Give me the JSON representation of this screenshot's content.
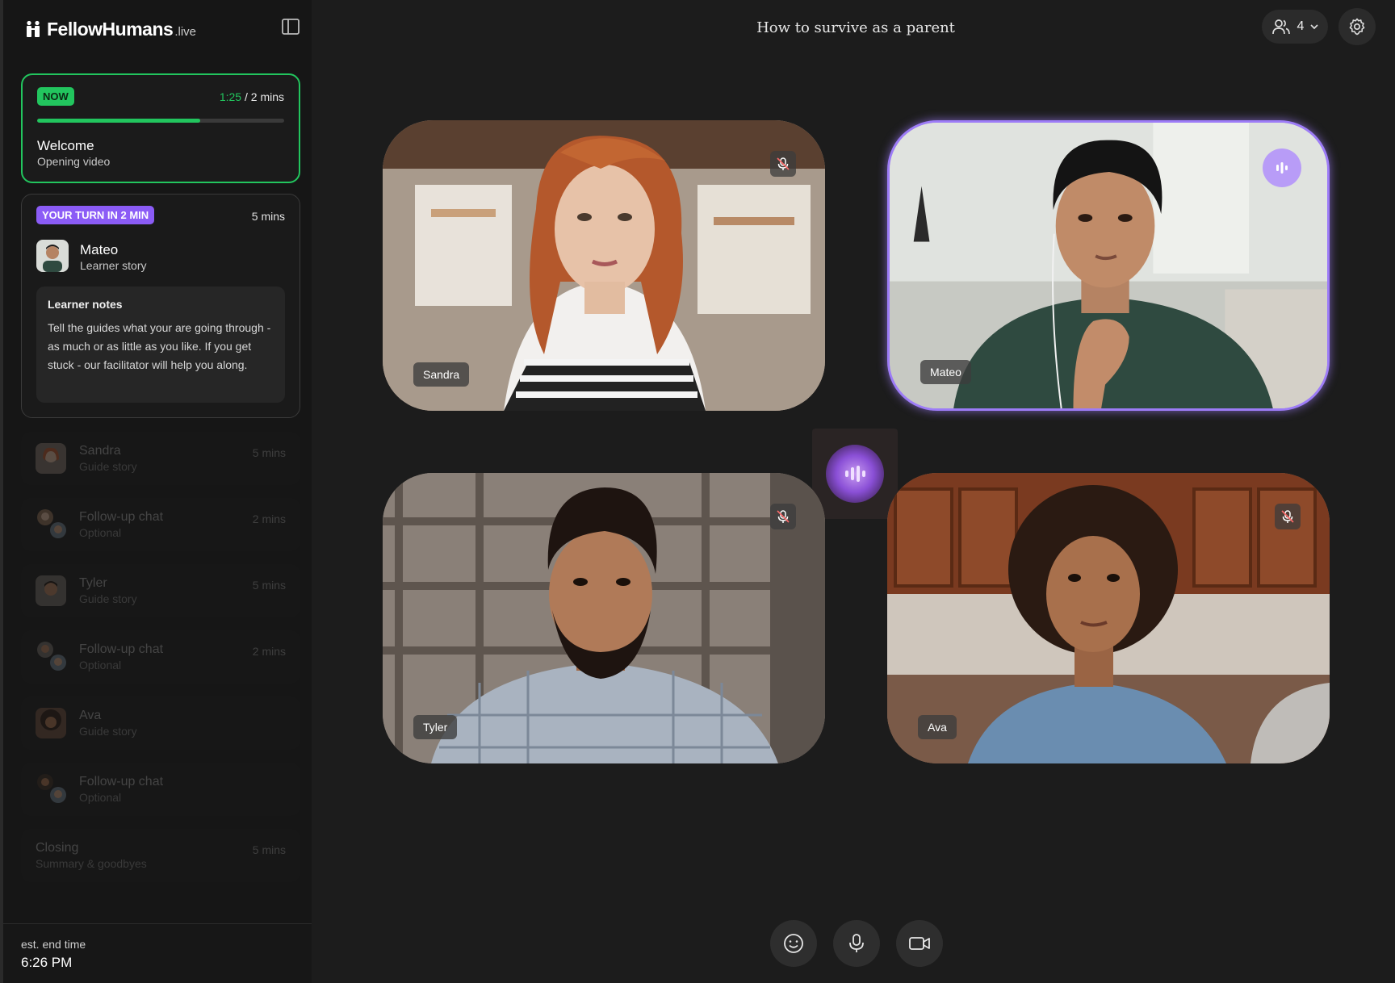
{
  "brand": {
    "name": "FellowHumans",
    "suffix": ".live"
  },
  "header": {
    "session_title": "How to survive as a parent",
    "participant_count": "4"
  },
  "now_card": {
    "badge": "NOW",
    "elapsed": "1:25",
    "total": " / 2 mins",
    "progress_percent": 66,
    "title": "Welcome",
    "subtitle": "Opening video"
  },
  "turn_card": {
    "badge": "YOUR TURN IN 2 MIN",
    "duration": "5 mins",
    "name": "Mateo",
    "subtitle": "Learner story",
    "notes_title": "Learner notes",
    "notes_body": "Tell the guides what your are going through - as much or as little as you like. If you get stuck - our facilitator will help you along."
  },
  "agenda": [
    {
      "name": "Sandra",
      "sub": "Guide story",
      "time": "5 mins"
    },
    {
      "name": "Follow-up chat",
      "sub": "Optional",
      "time": "2 mins"
    },
    {
      "name": "Tyler",
      "sub": "Guide story",
      "time": "5 mins"
    },
    {
      "name": "Follow-up chat",
      "sub": "Optional",
      "time": "2 mins"
    },
    {
      "name": "Ava",
      "sub": "Guide story",
      "time": ""
    },
    {
      "name": "Follow-up chat",
      "sub": "Optional",
      "time": ""
    },
    {
      "name": "Closing",
      "sub": "Summary & goodbyes",
      "time": "5 mins"
    }
  ],
  "footer": {
    "est_label": "est. end time",
    "est_value": "6:26 PM"
  },
  "tiles": {
    "sandra": {
      "name": "Sandra",
      "muted": true
    },
    "mateo": {
      "name": "Mateo",
      "speaking": true
    },
    "tyler": {
      "name": "Tyler",
      "muted": true
    },
    "ava": {
      "name": "Ava",
      "muted": true
    }
  },
  "icons": {
    "controls": [
      "emoji-icon",
      "microphone-icon",
      "video-camera-icon"
    ]
  },
  "colors": {
    "accent_green": "#22c55e",
    "accent_purple": "#8b5cf6",
    "speaking_glow": "#9d7cf7"
  }
}
